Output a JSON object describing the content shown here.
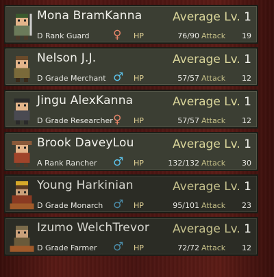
{
  "labels": {
    "level": "Average Lv.",
    "hp": "HP",
    "attack": "Attack"
  },
  "units": [
    {
      "name": "Mona BramKanna",
      "role": "D Rank Guard",
      "sex_symbol": "♀",
      "sex": "female",
      "level": "1",
      "hp": "76/90",
      "attack": "19",
      "avatar": "guard-sprite-icon"
    },
    {
      "name": "Nelson J.J.",
      "role": "D Grade Merchant",
      "sex_symbol": "♂",
      "sex": "male",
      "level": "1",
      "hp": "57/57",
      "attack": "12",
      "avatar": "merchant-sprite-icon"
    },
    {
      "name": "Jingu AlexKanna",
      "role": "D Grade Researcher",
      "sex_symbol": "♀",
      "sex": "female",
      "level": "1",
      "hp": "57/57",
      "attack": "12",
      "avatar": "researcher-sprite-icon"
    },
    {
      "name": "Brook DaveyLou",
      "role": "A Rank Rancher",
      "sex_symbol": "♂",
      "sex": "male",
      "level": "1",
      "hp": "132/132",
      "attack": "30",
      "avatar": "rancher-sprite-icon"
    },
    {
      "name": "Young Harkinian",
      "role": "D Grade Monarch",
      "sex_symbol": "♂",
      "sex": "male",
      "level": "1",
      "hp": "95/101",
      "attack": "23",
      "avatar": "monarch-sprite-icon"
    },
    {
      "name": "Izumo WelchTrevor",
      "role": "D Grade Farmer",
      "sex_symbol": "♂",
      "sex": "male",
      "level": "1",
      "hp": "72/72",
      "attack": "12",
      "avatar": "farmer-sprite-icon"
    }
  ]
}
